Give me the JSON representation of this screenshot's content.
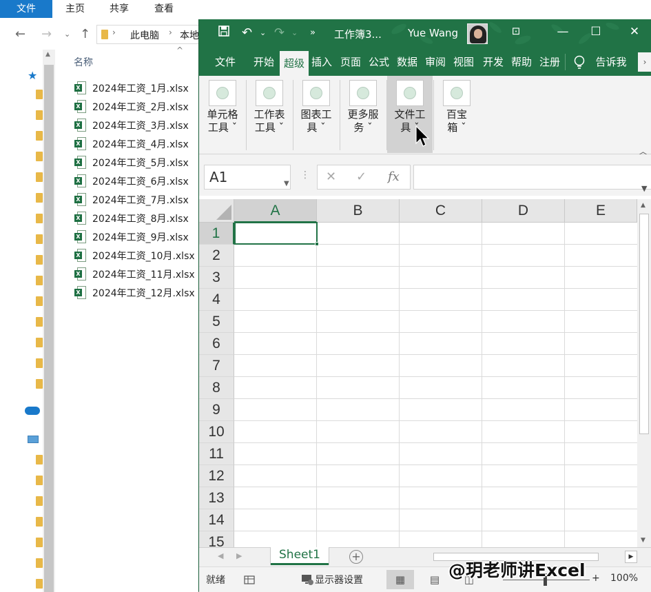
{
  "explorer": {
    "menu": [
      {
        "label": "文件",
        "active": true
      },
      {
        "label": "主页",
        "active": false
      },
      {
        "label": "共享",
        "active": false
      },
      {
        "label": "查看",
        "active": false
      }
    ],
    "breadcrumb": [
      "此电脑",
      "本地"
    ],
    "column_header": "名称",
    "files": [
      "2024年工资_1月.xlsx",
      "2024年工资_2月.xlsx",
      "2024年工资_3月.xlsx",
      "2024年工资_4月.xlsx",
      "2024年工资_5月.xlsx",
      "2024年工资_6月.xlsx",
      "2024年工资_7月.xlsx",
      "2024年工资_8月.xlsx",
      "2024年工资_9月.xlsx",
      "2024年工资_10月.xlsx",
      "2024年工资_11月.xlsx",
      "2024年工资_12月.xlsx"
    ]
  },
  "excel": {
    "title": "工作簿3...",
    "user": "Yue Wang",
    "tabs": [
      "文件",
      "开始",
      "超级",
      "插入",
      "页面",
      "公式",
      "数据",
      "审阅",
      "视图",
      "开发",
      "帮助",
      "注册",
      "告诉我"
    ],
    "active_tab": "超级",
    "ribbon_groups": [
      {
        "line1": "单元格",
        "line2": "工具 ˇ"
      },
      {
        "line1": "工作表",
        "line2": "工具 ˇ"
      },
      {
        "line1": "图表工",
        "line2": "具 ˇ"
      },
      {
        "line1": "更多服",
        "line2": "务 ˇ"
      },
      {
        "line1": "文件工",
        "line2": "具 ˇ"
      },
      {
        "line1": "百宝",
        "line2": "箱 ˇ"
      }
    ],
    "name_box": "A1",
    "formula_value": "",
    "columns": [
      "A",
      "B",
      "C",
      "D",
      "E"
    ],
    "rows": [
      "1",
      "2",
      "3",
      "4",
      "5",
      "6",
      "7",
      "8",
      "9",
      "10",
      "11",
      "12",
      "13",
      "14",
      "15"
    ],
    "active_cell": "A1",
    "sheet_tab": "Sheet1",
    "status_ready": "就绪",
    "display_settings": "显示器设置",
    "zoom": "100%",
    "accent": "#217346"
  },
  "watermark": "@玥老师讲Excel"
}
